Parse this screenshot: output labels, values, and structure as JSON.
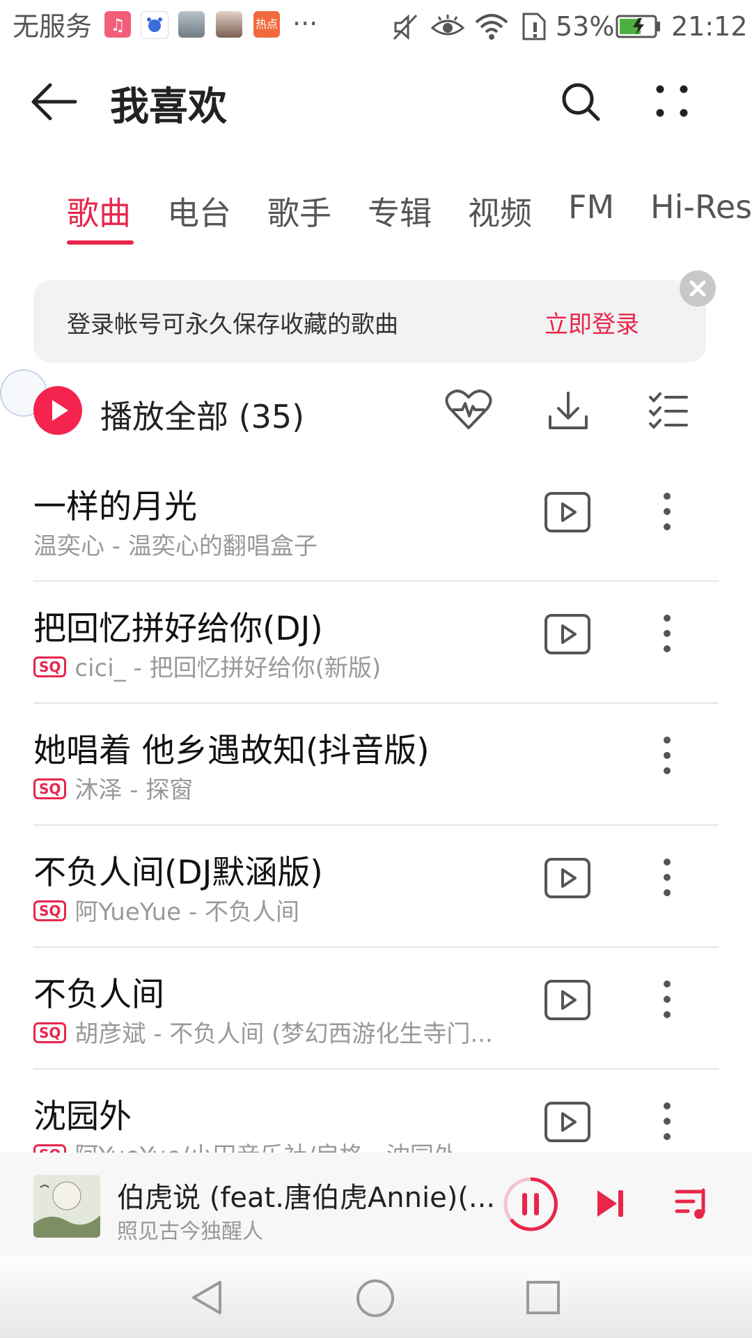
{
  "status_bar": {
    "carrier": "无服务",
    "more": "···",
    "battery": "53%",
    "time": "21:12",
    "app_icons": [
      "music-app-icon",
      "baidu-app-icon",
      "photo-app-icon",
      "avatar-app-icon",
      "hotspot-app-icon"
    ],
    "hotspot_label": "热点"
  },
  "header": {
    "title": "我喜欢"
  },
  "tabs": [
    {
      "label": "歌曲",
      "active": true
    },
    {
      "label": "电台",
      "active": false
    },
    {
      "label": "歌手",
      "active": false
    },
    {
      "label": "专辑",
      "active": false
    },
    {
      "label": "视频",
      "active": false
    },
    {
      "label": "FM",
      "active": false
    },
    {
      "label": "Hi-Res",
      "active": false
    }
  ],
  "banner": {
    "text": "登录帐号可永久保存收藏的歌曲",
    "action": "立即登录"
  },
  "play_all": {
    "label": "播放全部 (35)"
  },
  "songs": [
    {
      "title": "一样的月光",
      "subtitle": "温奕心 - 温奕心的翻唱盒子",
      "sq": false,
      "has_video": true
    },
    {
      "title": "把回忆拼好给你(DJ)",
      "subtitle": "cici_ - 把回忆拼好给你(新版)",
      "sq": true,
      "has_video": true
    },
    {
      "title": "她唱着 他乡遇故知(抖音版)",
      "subtitle": "沐泽 - 探窗",
      "sq": true,
      "has_video": false
    },
    {
      "title": "不负人间(DJ默涵版)",
      "subtitle": "阿YueYue - 不负人间",
      "sq": true,
      "has_video": true
    },
    {
      "title": "不负人间",
      "subtitle": "胡彦斌 - 不负人间 (梦幻西游化生寺门...",
      "sq": true,
      "has_video": true
    },
    {
      "title": "沈园外",
      "subtitle": "阿YueYue/小田音乐社/戾格 - 沈园外",
      "sq": true,
      "has_video": true
    }
  ],
  "sq_label": "SQ",
  "mini_player": {
    "title": "伯虎说 (feat.唐伯虎Annie)(...",
    "artist": "照见古今独醒人",
    "state": "playing"
  },
  "colors": {
    "accent": "#e8264b",
    "text_primary": "#222222",
    "text_secondary": "#999999"
  }
}
